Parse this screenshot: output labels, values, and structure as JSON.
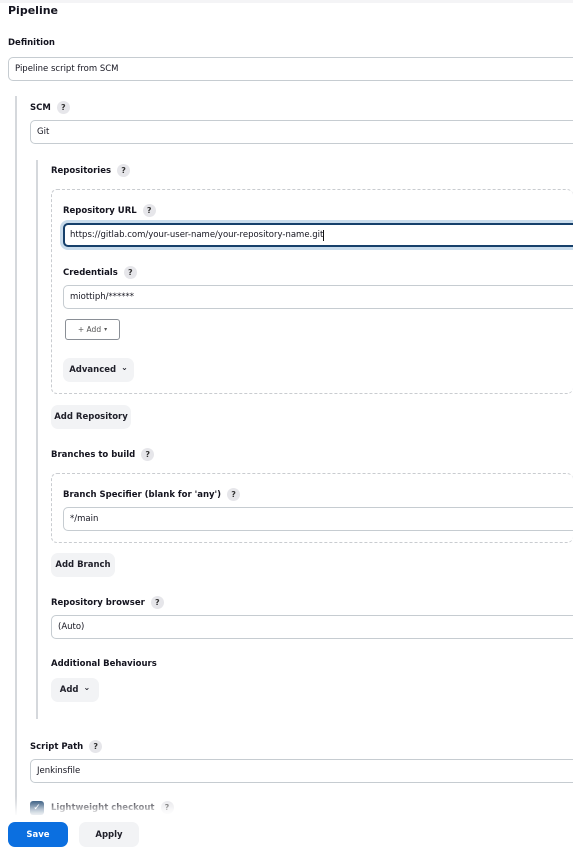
{
  "section_title": "Pipeline",
  "definition": {
    "label": "Definition",
    "value": "Pipeline script from SCM"
  },
  "scm": {
    "label": "SCM",
    "help": "?",
    "value": "Git"
  },
  "repositories": {
    "label": "Repositories",
    "help": "?",
    "url_label": "Repository URL",
    "url_help": "?",
    "url_value": "https://gitlab.com/your-user-name/your-repository-name.git",
    "credentials_label": "Credentials",
    "credentials_help": "?",
    "credentials_value": "miottiph/******",
    "add_credentials_label": "+ Add",
    "add_credentials_chevron": "▾",
    "advanced_label": "Advanced",
    "advanced_chevron": "⌄",
    "add_repository_label": "Add Repository"
  },
  "branches": {
    "label": "Branches to build",
    "help": "?",
    "specifier_label": "Branch Specifier (blank for 'any')",
    "specifier_help": "?",
    "specifier_value": "*/main",
    "add_branch_label": "Add Branch"
  },
  "repo_browser": {
    "label": "Repository browser",
    "help": "?",
    "value": "(Auto)"
  },
  "additional_behaviours": {
    "label": "Additional Behaviours",
    "add_label": "Add",
    "add_chevron": "⌄"
  },
  "script_path": {
    "label": "Script Path",
    "help": "?",
    "value": "Jenkinsfile"
  },
  "lightweight_checkout": {
    "label": "Lightweight checkout",
    "help": "?",
    "checked": true,
    "check_glyph": "✓"
  },
  "footer": {
    "save_label": "Save",
    "apply_label": "Apply"
  },
  "colors": {
    "primary": "#0b6fe0",
    "focus_border": "#16406b",
    "checkbox": "#16406b"
  }
}
